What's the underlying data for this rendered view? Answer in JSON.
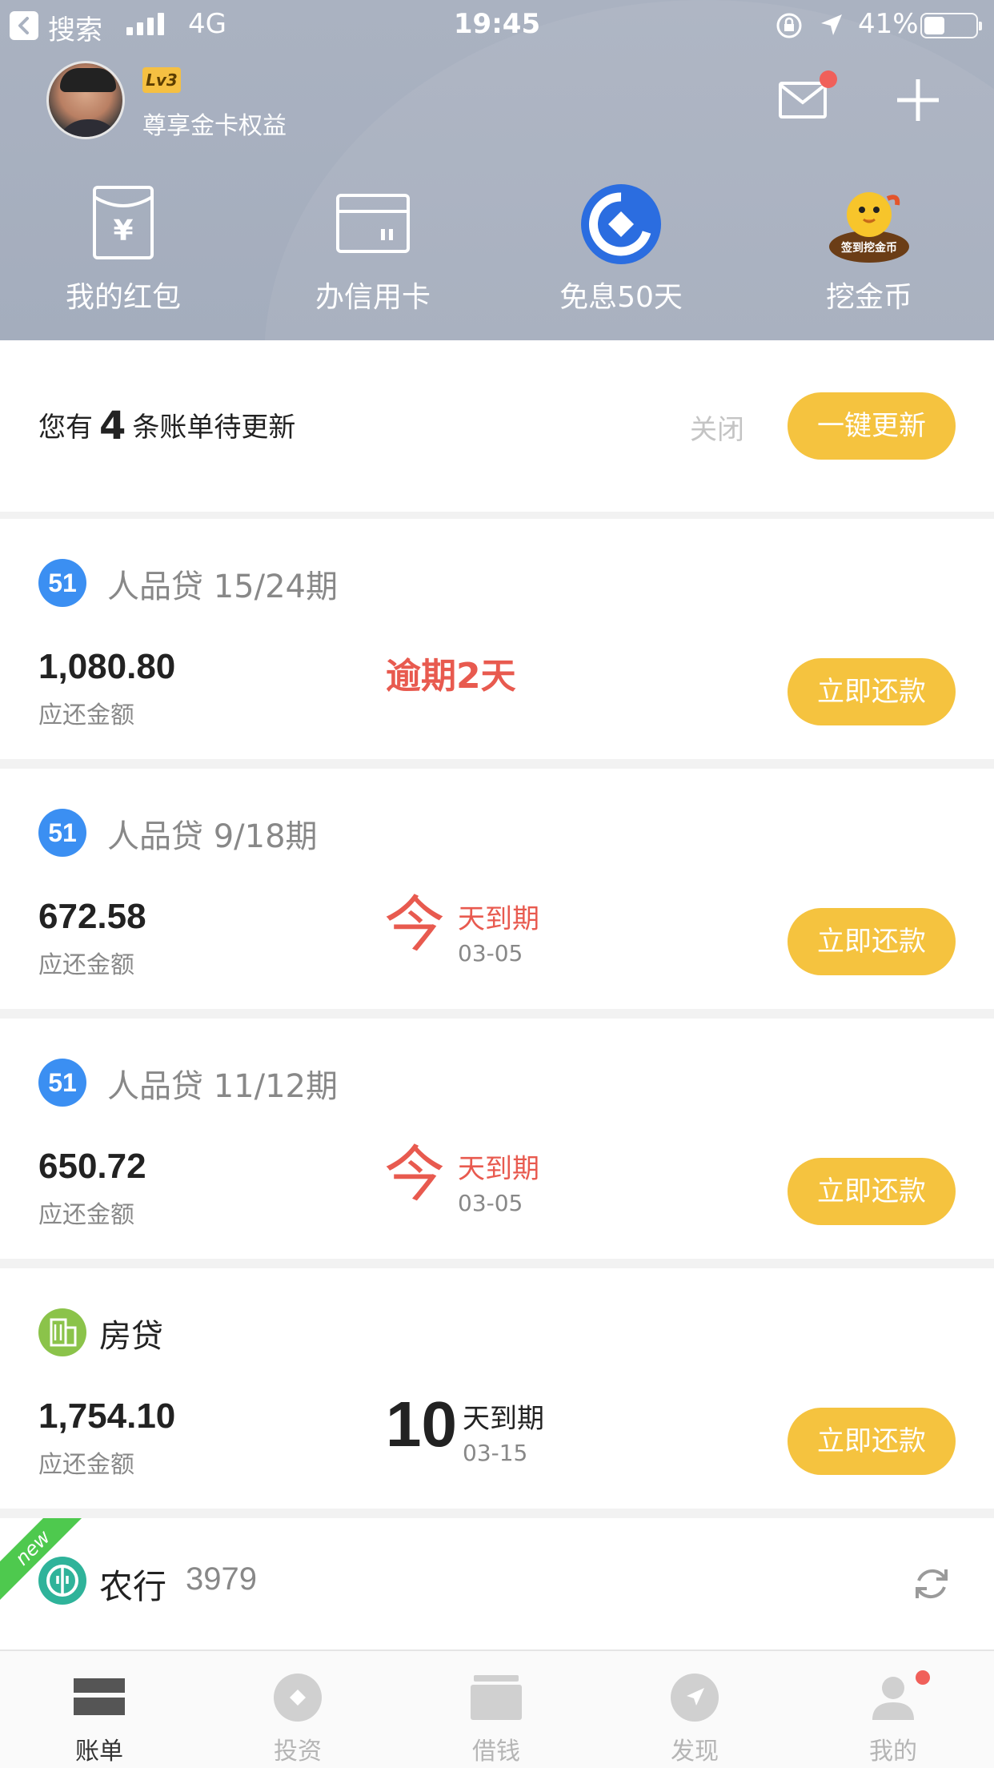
{
  "status_bar": {
    "back_label": "搜索",
    "network": "4G",
    "time": "19:45",
    "battery_percent": "41%",
    "battery_level": 0.41
  },
  "profile": {
    "level": "Lv3",
    "member_text": "尊享金卡权益"
  },
  "header_actions": [
    "mail-icon",
    "plus-icon"
  ],
  "quick_actions": [
    {
      "label": "我的红包",
      "icon": "red-envelope-icon"
    },
    {
      "label": "办信用卡",
      "icon": "credit-card-icon"
    },
    {
      "label": "免息50天",
      "icon": "bank-logo-icon"
    },
    {
      "label": "挖金币",
      "icon": "gold-digging-mascot-icon",
      "badge_text": "签到挖金币"
    }
  ],
  "notice": {
    "prefix": "您有",
    "count": "4",
    "suffix": "条账单待更新",
    "close_label": "关闭",
    "update_label": "一键更新"
  },
  "bills": [
    {
      "logo": "51",
      "title": "人品贷 15/24期",
      "amount": "1,080.80",
      "amount_label": "应还金额",
      "status": "逾期2天",
      "pay_label": "立即还款"
    },
    {
      "logo": "51",
      "title": "人品贷 9/18期",
      "amount": "672.58",
      "amount_label": "应还金额",
      "due_big": "今",
      "due_text": "天到期",
      "due_date": "03-05",
      "pay_label": "立即还款"
    },
    {
      "logo": "51",
      "title": "人品贷 11/12期",
      "amount": "650.72",
      "amount_label": "应还金额",
      "due_big": "今",
      "due_text": "天到期",
      "due_date": "03-05",
      "pay_label": "立即还款"
    },
    {
      "logo": "building-icon",
      "title": "房贷",
      "amount": "1,754.10",
      "amount_label": "应还金额",
      "due_big": "10",
      "due_text": "天到期",
      "due_date": "03-15",
      "pay_label": "立即还款"
    }
  ],
  "bank_row": {
    "ribbon": "new",
    "name": "农行",
    "number": "3979"
  },
  "tabs": [
    {
      "label": "账单",
      "icon": "bill-icon",
      "active": true
    },
    {
      "label": "投资",
      "icon": "invest-icon"
    },
    {
      "label": "借钱",
      "icon": "borrow-icon"
    },
    {
      "label": "发现",
      "icon": "discover-icon"
    },
    {
      "label": "我的",
      "icon": "profile-icon",
      "has_dot": true
    }
  ],
  "colors": {
    "header_bg": "#a8b0bf",
    "accent_yellow": "#f5c33f",
    "alert_red": "#e85a4f",
    "logo_blue": "#3b8ff2",
    "fang_green": "#8bc34a",
    "bank_teal": "#2fb39a"
  }
}
